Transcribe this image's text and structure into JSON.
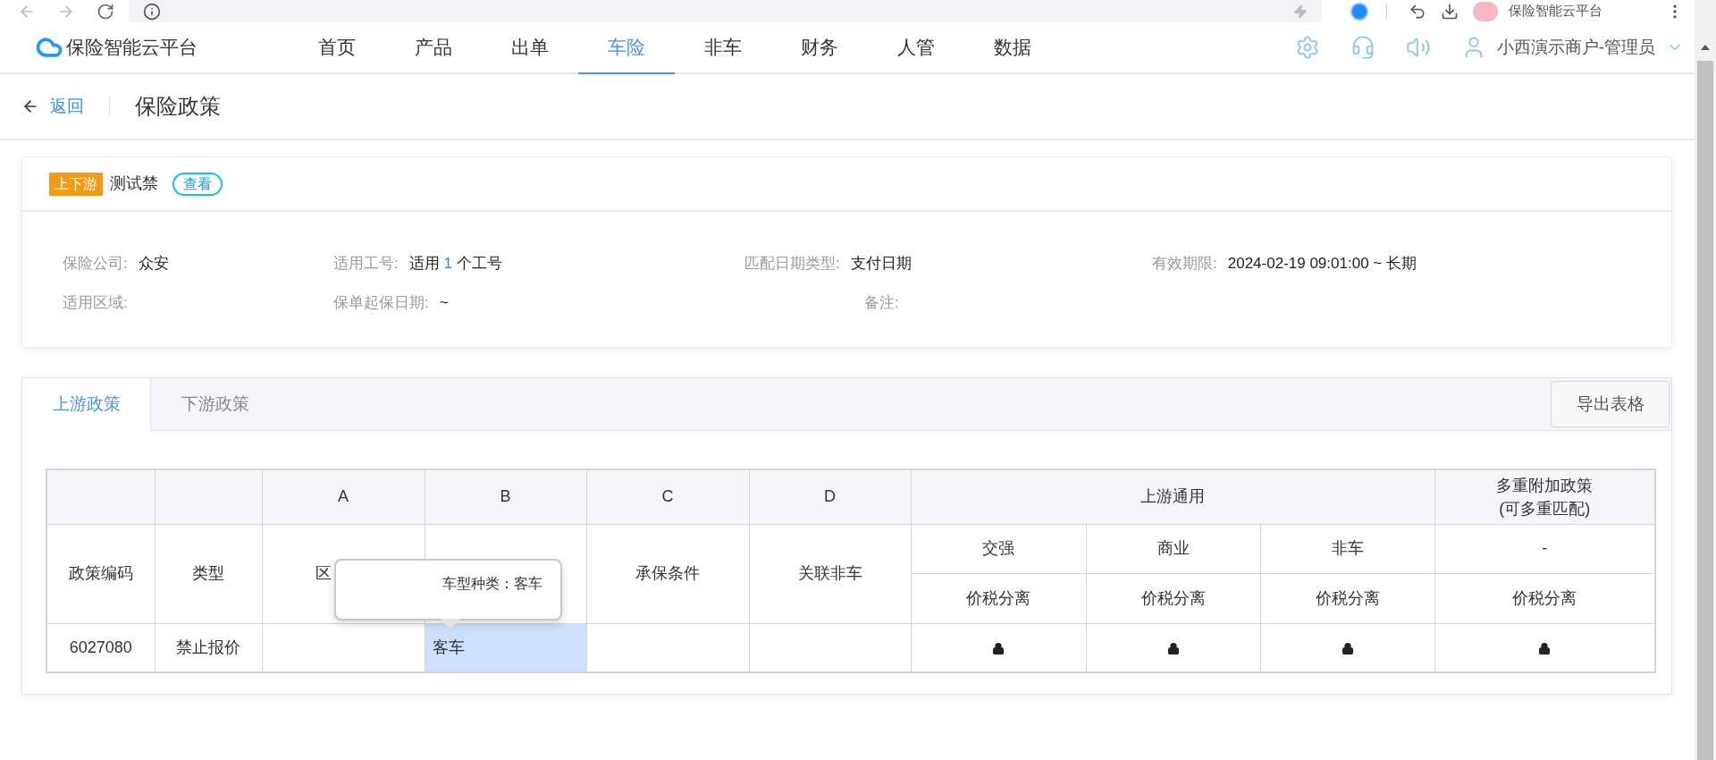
{
  "browser": {
    "profile_name": "保险智能云平台"
  },
  "header": {
    "logo_text": "保险智能云平台",
    "nav": [
      {
        "label": "首页",
        "selected": false
      },
      {
        "label": "产品",
        "selected": false
      },
      {
        "label": "出单",
        "selected": false
      },
      {
        "label": "车险",
        "selected": true
      },
      {
        "label": "非车",
        "selected": false
      },
      {
        "label": "财务",
        "selected": false
      },
      {
        "label": "人管",
        "selected": false
      },
      {
        "label": "数据",
        "selected": false
      }
    ],
    "user_name": "小西演示商户-管理员"
  },
  "breadcrumb": {
    "back_label": "返回",
    "title": "保险政策"
  },
  "policy_card": {
    "tag": "上下游",
    "name": "测试禁",
    "view_button": "查看",
    "rows": [
      [
        {
          "label": "保险公司:",
          "value_parts": [
            {
              "text": "众安",
              "highlight": false
            }
          ]
        },
        {
          "label": "适用工号:",
          "value_parts": [
            {
              "text": "适用 ",
              "highlight": false
            },
            {
              "text": "1",
              "highlight": true
            },
            {
              "text": " 个工号",
              "highlight": false
            }
          ]
        },
        {
          "label": "匹配日期类型:",
          "value_parts": [
            {
              "text": "支付日期",
              "highlight": false
            }
          ]
        },
        {
          "label": "有效期限:",
          "value_parts": [
            {
              "text": "2024-02-19 09:01:00 ~ 长期",
              "highlight": false
            }
          ]
        }
      ],
      [
        {
          "label": "适用区域:"
        },
        {
          "label": "保单起保日期:",
          "value_parts": [
            {
              "text": "~",
              "highlight": false
            }
          ]
        },
        {
          "label": "备注:"
        }
      ]
    ]
  },
  "tabs": [
    {
      "label": "上游政策",
      "selected": true
    },
    {
      "label": "下游政策",
      "selected": false
    }
  ],
  "export_button": "导出表格",
  "table": {
    "group_row": [
      "A",
      "B",
      "C",
      "D"
    ],
    "upstream_group": "上游通用",
    "multi_group": "多重附加政策\n(可多重匹配)",
    "column_headers": [
      "政策编码",
      "类型",
      "区",
      "承保条件",
      "关联非车"
    ],
    "sub_headers": [
      "交强",
      "商业",
      "非车",
      "-"
    ],
    "sub_sub_headers": [
      "价税分离",
      "价税分离",
      "价税分离",
      "价税分离"
    ],
    "rows": [
      {
        "cells": [
          {
            "kind": "text",
            "text": "6027080",
            "selected": false
          },
          {
            "kind": "text",
            "text": "禁止报价",
            "selected": false
          },
          {
            "kind": "empty",
            "selected": false
          },
          {
            "kind": "text",
            "text": "客车",
            "selected": true
          },
          {
            "kind": "empty",
            "selected": false
          },
          {
            "kind": "empty",
            "selected": false
          },
          {
            "kind": "lock",
            "selected": false
          },
          {
            "kind": "lock",
            "selected": false
          },
          {
            "kind": "lock",
            "selected": false
          },
          {
            "kind": "lock",
            "selected": false
          }
        ]
      }
    ],
    "tooltip": "车型种类：客车"
  }
}
